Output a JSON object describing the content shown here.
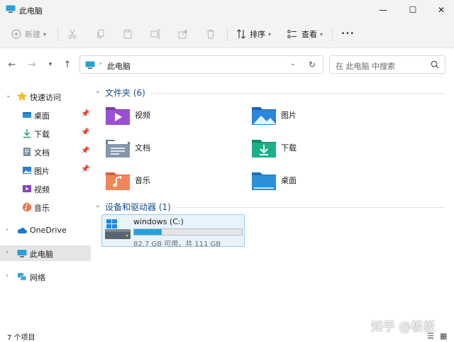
{
  "window": {
    "title": "此电脑",
    "minimize": "—",
    "maximize": "☐",
    "close": "✕"
  },
  "toolbar": {
    "new_label": "新建",
    "sort_label": "排序",
    "view_label": "查看",
    "more_label": "•••"
  },
  "address": {
    "current": "此电脑"
  },
  "search": {
    "placeholder": "在 此电脑 中搜索"
  },
  "sidebar": {
    "quick_access": "快速访问",
    "items": [
      {
        "label": "桌面",
        "icon": "desktop-icon"
      },
      {
        "label": "下载",
        "icon": "download-icon"
      },
      {
        "label": "文档",
        "icon": "document-icon"
      },
      {
        "label": "图片",
        "icon": "pictures-icon"
      },
      {
        "label": "视频",
        "icon": "videos-icon"
      },
      {
        "label": "音乐",
        "icon": "music-icon"
      }
    ],
    "onedrive": "OneDrive",
    "this_pc": "此电脑",
    "network": "网络"
  },
  "folders_group": {
    "header": "文件夹 (6)",
    "items": [
      "视频",
      "图片",
      "文档",
      "下载",
      "音乐",
      "桌面"
    ]
  },
  "devices_group": {
    "header": "设备和驱动器 (1)"
  },
  "drive": {
    "name": "windows (C:)",
    "info": "82.7 GB 可用，共 111 GB",
    "used_fraction": 0.255
  },
  "status": {
    "item_count": "7 个项目"
  },
  "watermark": "知乎 @板板",
  "colors": {
    "accent": "#26a0da",
    "selection": "#e5e5e5",
    "group_header": "#1a4e8c"
  }
}
